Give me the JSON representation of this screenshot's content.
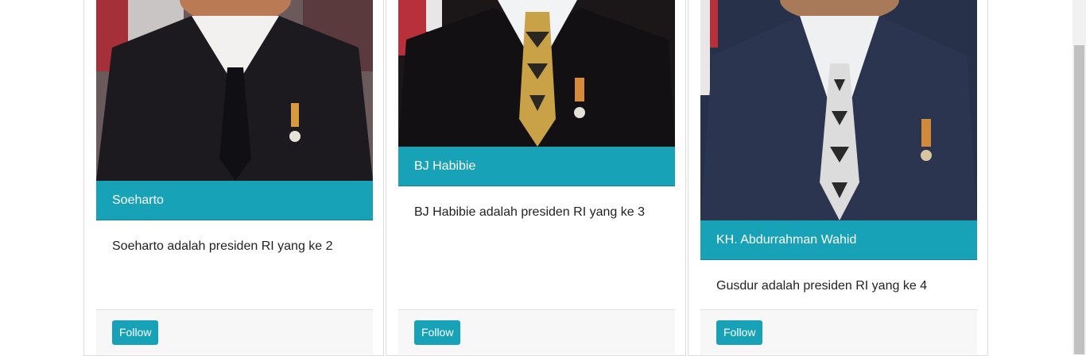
{
  "cards": [
    {
      "name": "Soeharto",
      "description": "Soeharto adalah presiden RI yang ke 2",
      "button_label": "Follow"
    },
    {
      "name": "BJ Habibie",
      "description": "BJ Habibie adalah presiden RI yang ke 3",
      "button_label": "Follow"
    },
    {
      "name": "KH. Abdurrahman Wahid",
      "description": "Gusdur adalah presiden RI yang ke 4",
      "button_label": "Follow"
    }
  ],
  "colors": {
    "accent": "#17a2b8",
    "footer_bg": "#f7f7f7"
  }
}
